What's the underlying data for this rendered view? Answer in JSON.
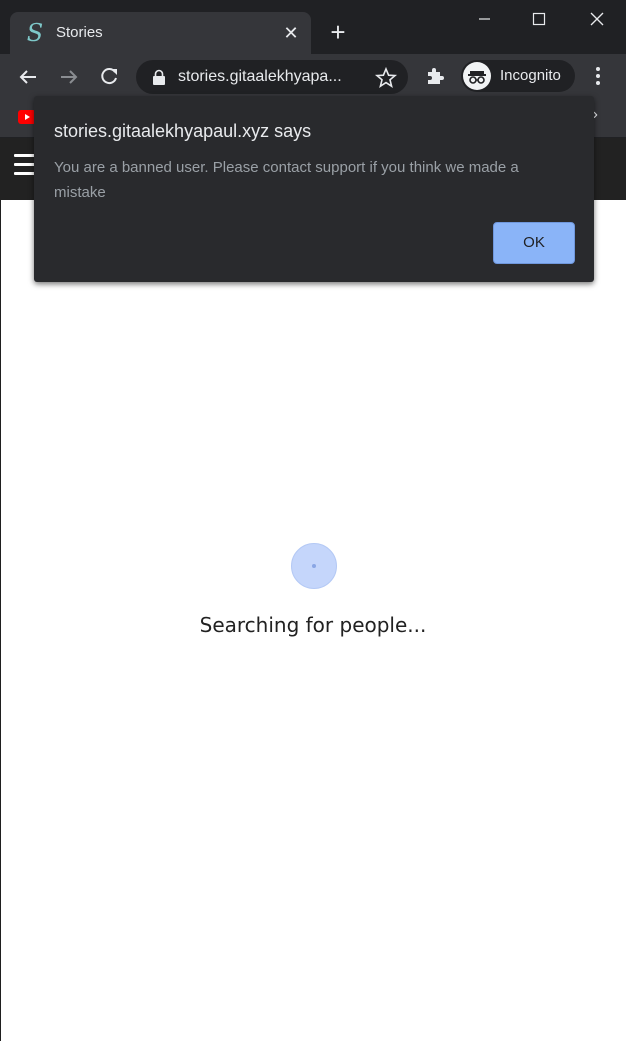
{
  "browser": {
    "tab": {
      "favicon_letter": "S",
      "title": "Stories"
    },
    "url": "stories.gitaalekhyapa...",
    "profile_label": "Incognito",
    "bookmarks_more": "»",
    "icons": [
      "back-icon",
      "forward-icon",
      "reload-icon",
      "lock-icon",
      "star-icon",
      "extensions-icon",
      "incognito-icon",
      "menu-icon",
      "youtube-icon",
      "minimize-icon",
      "maximize-icon",
      "close-icon",
      "new-tab-icon"
    ]
  },
  "dialog": {
    "title": "stories.gitaalekhyapaul.xyz says",
    "message": "You are a banned user. Please contact support if you think we made a mistake",
    "ok_label": "OK"
  },
  "page": {
    "loading_text": "Searching for people..."
  },
  "colors": {
    "chrome_dark": "#202124",
    "chrome_toolbar": "#35363a",
    "dialog_bg": "#292a2d",
    "button_accent": "#8ab4f8",
    "spinner": "#c5d6fb",
    "page_header": "#222222"
  }
}
